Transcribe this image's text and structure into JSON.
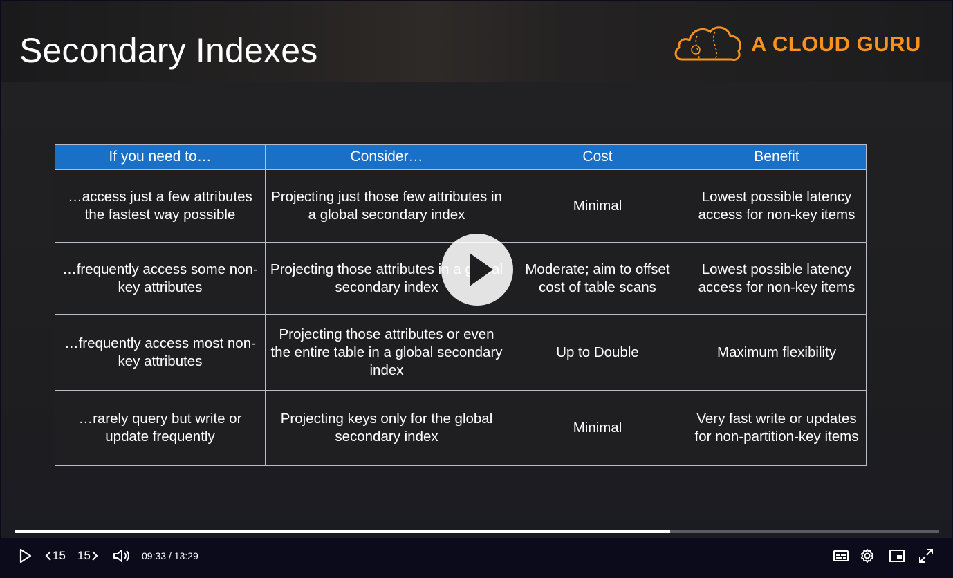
{
  "slide": {
    "title": "Secondary Indexes",
    "logo_text": "A CLOUD GURU",
    "brand_color": "#f7921e",
    "header_color": "#1a6fc6"
  },
  "table": {
    "headers": [
      "If you need to…",
      "Consider…",
      "Cost",
      "Benefit"
    ],
    "rows": [
      [
        "…access just a few attributes the fastest way possible",
        "Projecting just those few attributes in a global secondary index",
        "Minimal",
        "Lowest possible latency access for non-key items"
      ],
      [
        "…frequently access some non-key attributes",
        "Projecting those attributes in a global secondary index",
        "Moderate; aim to offset cost of table scans",
        "Lowest possible latency access for non-key items"
      ],
      [
        "…frequently access most non-key attributes",
        "Projecting those attributes or even the entire table in a global secondary index",
        "Up to Double",
        "Maximum flexibility"
      ],
      [
        "…rarely query but write or update frequently",
        "Projecting keys only for the global secondary index",
        "Minimal",
        "Very fast write or updates for non-partition-key items"
      ]
    ]
  },
  "player": {
    "current_time": "09:33",
    "duration": "13:29",
    "time_display": "09:33 / 13:29",
    "progress": 0.709,
    "skip_back_label": "15",
    "skip_forward_label": "15",
    "icons": [
      "play-icon",
      "rewind-15-icon",
      "forward-15-icon",
      "volume-icon",
      "captions-icon",
      "settings-icon",
      "picture-in-picture-icon",
      "fullscreen-icon",
      "big-play-icon"
    ]
  }
}
